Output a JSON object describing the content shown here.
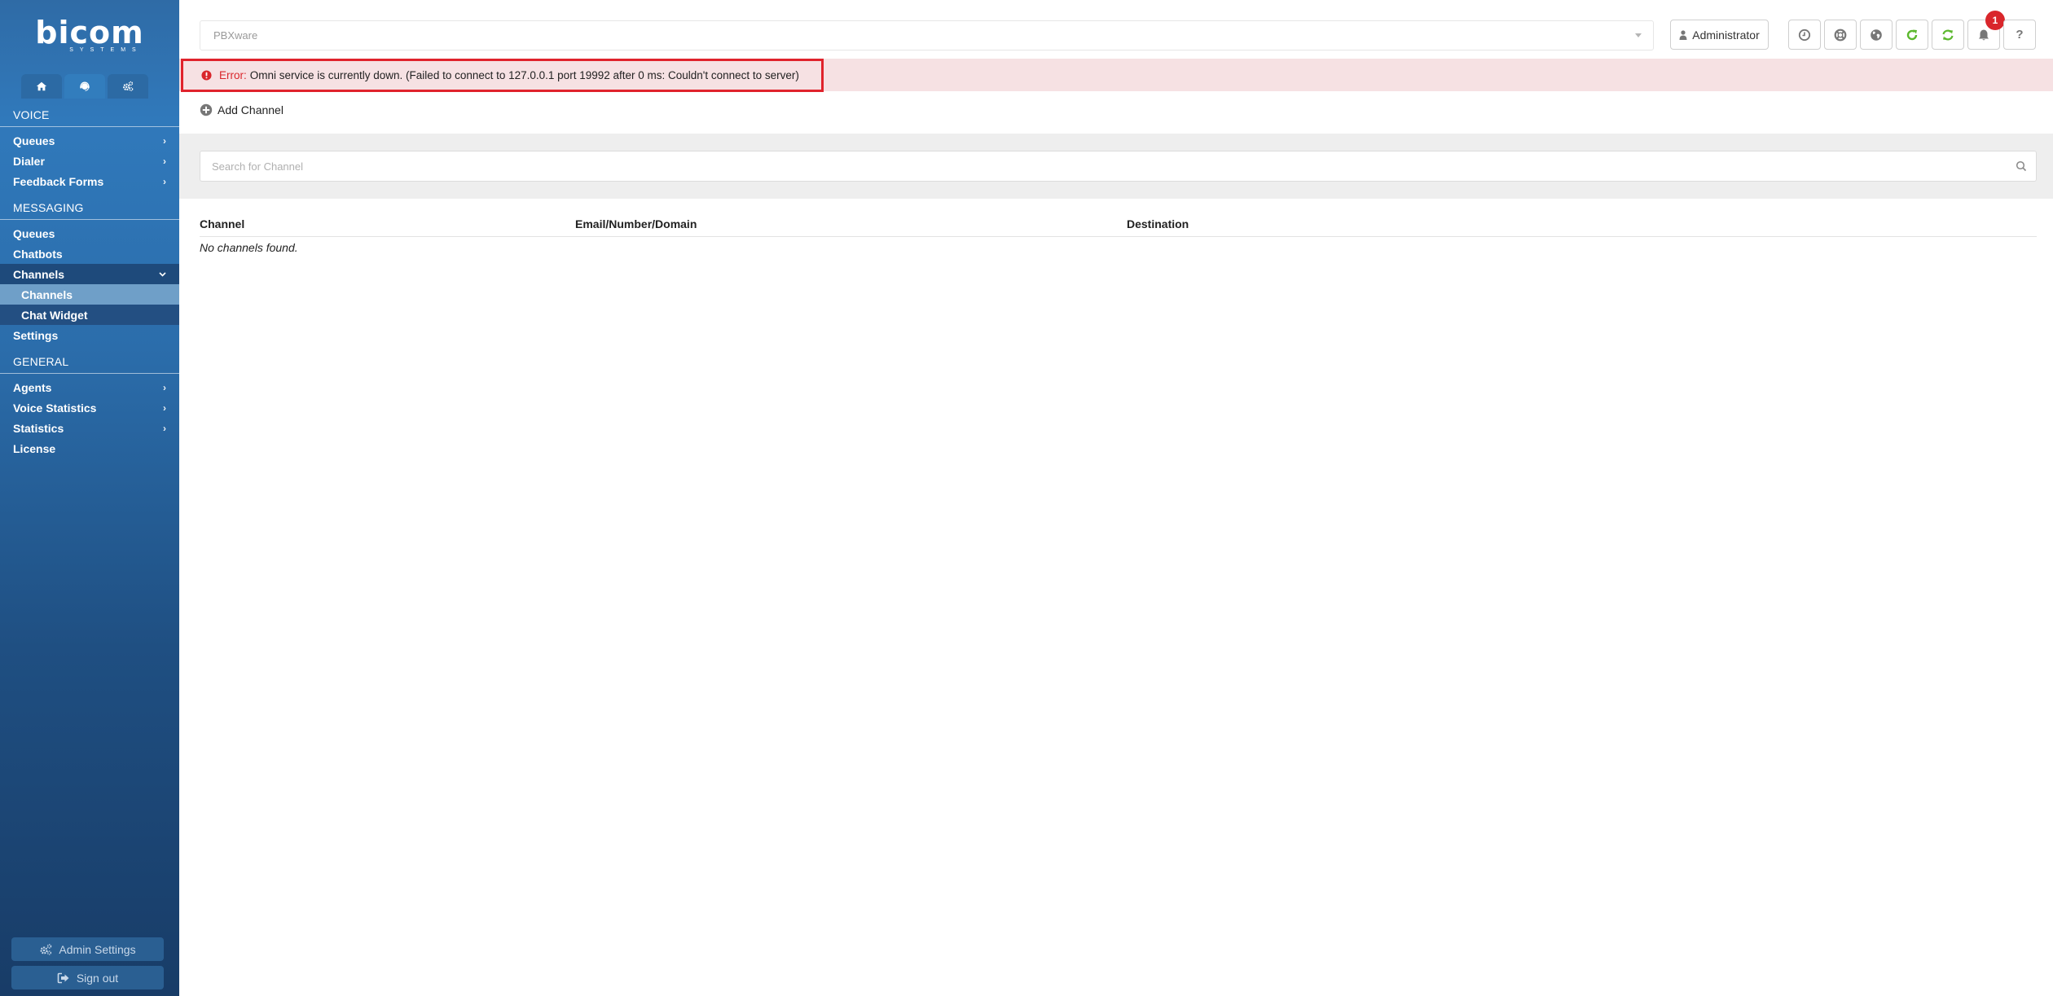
{
  "sidebar": {
    "logo": {
      "main": "bicom",
      "sub": "SYSTEMS"
    },
    "nav_tabs": [
      {
        "name": "home",
        "icon": "home-icon",
        "active": false
      },
      {
        "name": "contact-center",
        "icon": "headset-icon",
        "active": true
      },
      {
        "name": "settings",
        "icon": "cogs-icon",
        "active": false
      }
    ],
    "sections": {
      "voice": "VOICE",
      "messaging": "MESSAGING",
      "general": "GENERAL"
    },
    "voice_items": {
      "queues": "Queues",
      "dialer": "Dialer",
      "feedback_forms": "Feedback Forms"
    },
    "messaging_items": {
      "queues": "Queues",
      "chatbots": "Chatbots",
      "channels": "Channels",
      "channels_sub": "Channels",
      "chat_widget": "Chat Widget",
      "settings": "Settings"
    },
    "general_items": {
      "agents": "Agents",
      "voice_statistics": "Voice Statistics",
      "statistics": "Statistics",
      "license": "License"
    },
    "chevron_right": "›",
    "chevron_down": "⌄",
    "admin_settings": "Admin Settings",
    "sign_out": "Sign out"
  },
  "topbar": {
    "product_select": "PBXware",
    "user": "Administrator",
    "icons": [
      "clock-icon",
      "lifebuoy-icon",
      "globe-icon",
      "reload-icon",
      "sync-icon",
      "bell-icon",
      "help-icon"
    ],
    "notification_count": "1",
    "help_label": "?"
  },
  "error": {
    "label": "Error:",
    "message": "Omni service is currently down. (Failed to connect to 127.0.0.1 port 19992 after 0 ms: Couldn't connect to server)"
  },
  "main": {
    "add_channel": "Add Channel",
    "search_placeholder": "Search for Channel",
    "table": {
      "columns": [
        "Channel",
        "Email/Number/Domain",
        "Destination"
      ],
      "rows": [],
      "empty_text": "No channels found."
    }
  },
  "colors": {
    "accent_green": "#5cb82e",
    "error_red": "#d9262b",
    "error_bg": "#f6e1e3",
    "sidebar_blue": "#2f6ba6"
  }
}
